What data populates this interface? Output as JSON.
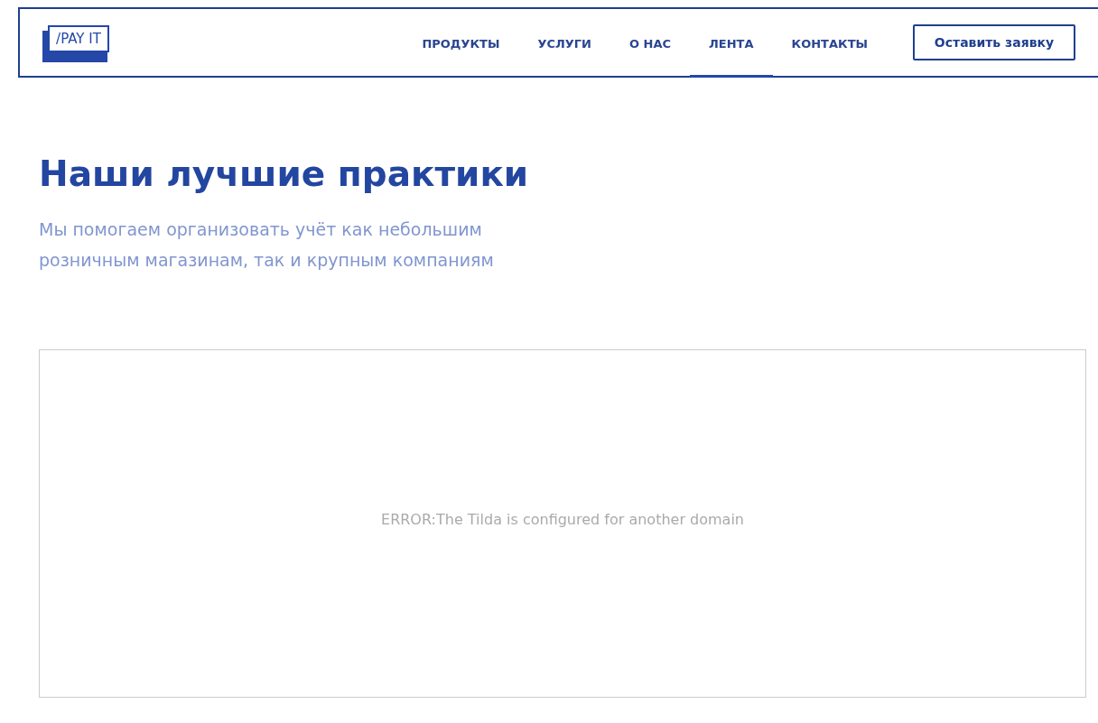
{
  "header": {
    "logo": "/PAY IT",
    "nav": [
      {
        "label": "ПРОДУКТЫ",
        "selected": false
      },
      {
        "label": "УСЛУГИ",
        "selected": false
      },
      {
        "label": "О НАС",
        "selected": false
      },
      {
        "label": "ЛЕНТА",
        "selected": true
      },
      {
        "label": "КОНТАКТЫ",
        "selected": false
      }
    ],
    "cta": "Оставить заявку"
  },
  "hero": {
    "title": "Наши лучшие практики",
    "subtitle": "Мы помогаем организовать учёт как небольшим розничным магазинам, так и крупным компаниям"
  },
  "embed": {
    "message": "ERROR:The Tilda is configured for another domain"
  }
}
